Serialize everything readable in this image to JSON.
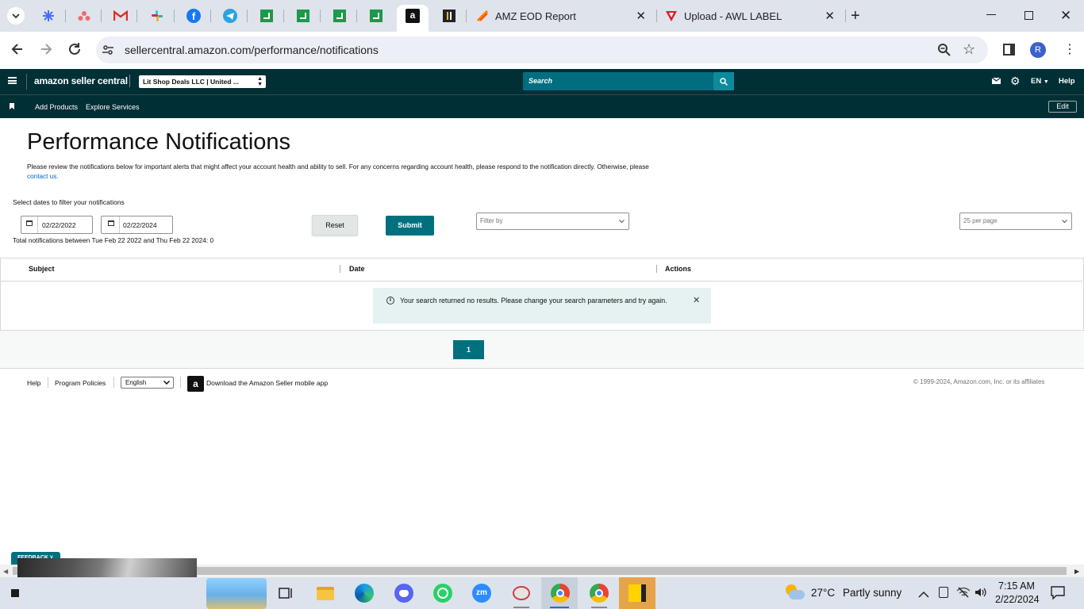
{
  "browser": {
    "tabs": {
      "tab1": "AMZ EOD Report",
      "tab2": "Upload - AWL LABEL"
    },
    "url": "sellercentral.amazon.com/performance/notifications",
    "profile_initial": "R"
  },
  "header": {
    "logo_text": "amazon seller central",
    "store": "Lit Shop Deals LLC | United ...",
    "search_placeholder": "Search",
    "lang": "EN",
    "help": "Help"
  },
  "nav": {
    "add_products": "Add Products",
    "explore_services": "Explore Services",
    "edit": "Edit"
  },
  "page": {
    "title": "Performance Notifications",
    "description": "Please review the notifications below for important alerts that might affect your account health and ability to sell. For any concerns regarding account health, please respond to the notification directly. Otherwise, please",
    "contact_link": "contact us.",
    "filter_label": "Select dates to filter your notifications",
    "date_from": "02/22/2022",
    "date_to": "02/22/2024",
    "reset": "Reset",
    "submit": "Submit",
    "filter_by": "Filter by",
    "per_page": "25 per page",
    "total_text": "Total notifications between Tue Feb 22 2022 and Thu Feb 22 2024: 0"
  },
  "table": {
    "col_subject": "Subject",
    "col_date": "Date",
    "col_actions": "Actions",
    "no_results": "Your search returned no results. Please change your search parameters and try again."
  },
  "pagination": {
    "current": "1"
  },
  "footer": {
    "help": "Help",
    "program_policies": "Program Policies",
    "language": "English",
    "download_app": "Download the Amazon Seller mobile app",
    "copyright": "© 1999-2024, Amazon.com, Inc. or its affiliates"
  },
  "feedback": "FEEDBACK",
  "taskbar": {
    "weather_temp": "27°C",
    "weather_desc": "Partly sunny",
    "time": "7:15 AM",
    "date": "2/22/2024"
  },
  "colors": {
    "header_bg": "#002f36",
    "teal": "#00707f",
    "search_bg": "#006e7f"
  }
}
